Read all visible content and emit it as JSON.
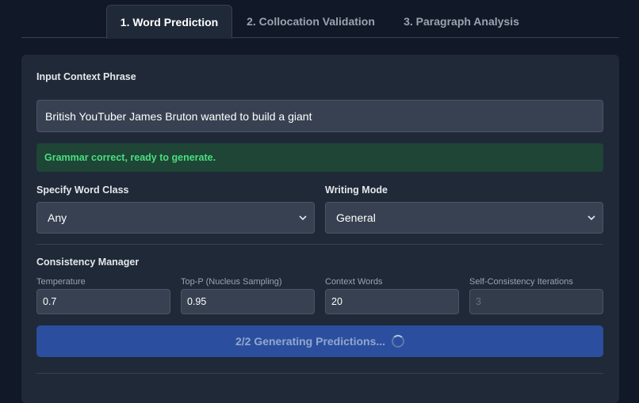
{
  "tabs": [
    {
      "label": "1. Word Prediction"
    },
    {
      "label": "2. Collocation Validation"
    },
    {
      "label": "3. Paragraph Analysis"
    }
  ],
  "input_section": {
    "label": "Input Context Phrase",
    "value": "British YouTuber James Bruton wanted to build a giant"
  },
  "status": {
    "text": "Grammar correct, ready to generate.",
    "color": "#4ade80"
  },
  "word_class": {
    "label": "Specify Word Class",
    "selected": "Any"
  },
  "writing_mode": {
    "label": "Writing Mode",
    "selected": "General"
  },
  "consistency": {
    "title": "Consistency Manager",
    "fields": [
      {
        "label": "Temperature",
        "value": "0.7"
      },
      {
        "label": "Top-P (Nucleus Sampling)",
        "value": "0.95"
      },
      {
        "label": "Context Words",
        "value": "20"
      },
      {
        "label": "Self-Consistency Iterations",
        "value": "3"
      }
    ]
  },
  "generate_button": {
    "label": "2/2 Generating Predictions...",
    "color": "#2b4f9e"
  },
  "icons": {
    "dropdown": "chevron-down-icon",
    "loading": "spinner-icon"
  }
}
